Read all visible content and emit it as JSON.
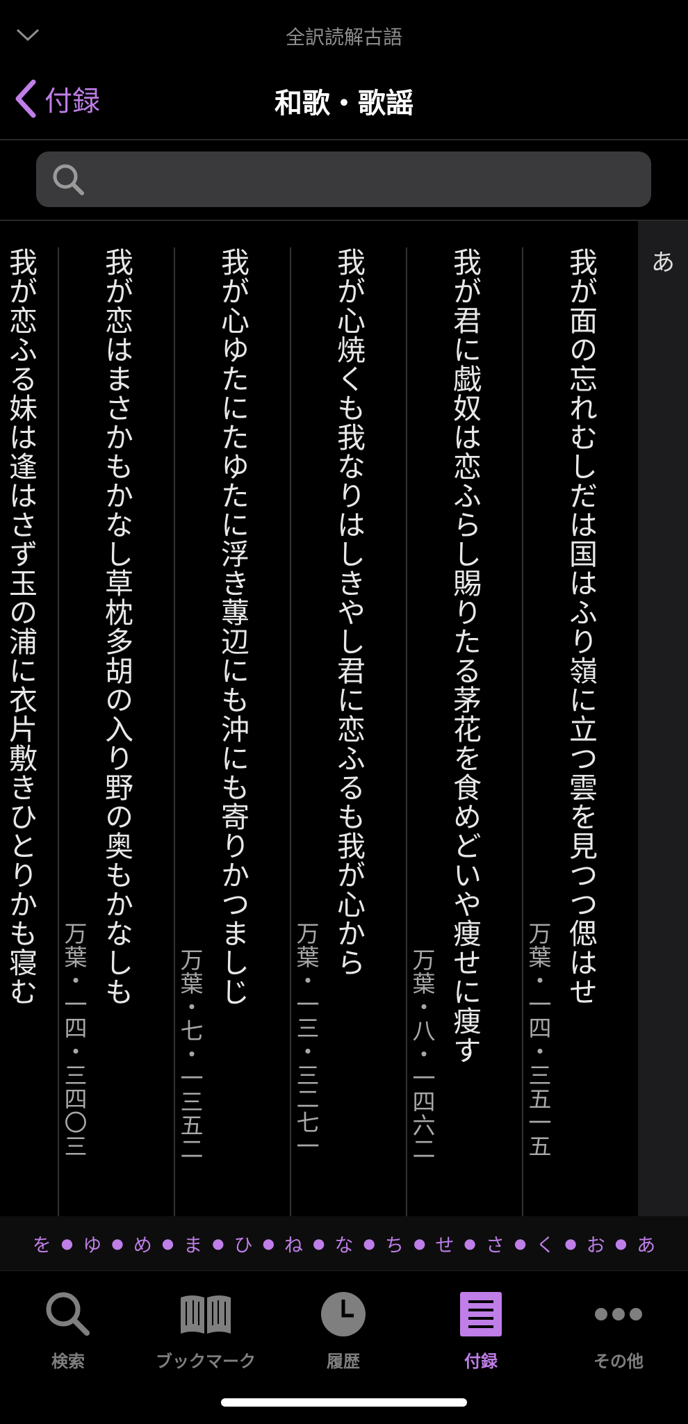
{
  "app": {
    "name": "全訳読解古語"
  },
  "nav": {
    "back_label": "付録",
    "title": "和歌・歌謡"
  },
  "search": {
    "placeholder": "",
    "value": ""
  },
  "poems": [
    {
      "text": "我が面の忘れむしだは国はふり嶺に立つ雲を見つつ偲はせ",
      "source": "万葉・一四・三五一五"
    },
    {
      "text": "我が君に戯奴は恋ふらし賜りたる茅花を食めどいや痩せに痩す",
      "source": "万葉・八・一四六二"
    },
    {
      "text": "我が心焼くも我なりはしきやし君に恋ふるも我が心から",
      "source": "万葉・一三・三二七一"
    },
    {
      "text": "我が心ゆたにたゆたに浮き蓴辺にも沖にも寄りかつましじ",
      "source": "万葉・七・一三五二"
    },
    {
      "text": "我が恋はまさかもかなし草枕多胡の入り野の奥もかなしも",
      "source": "万葉・一四・三四〇三"
    },
    {
      "text": "我が恋ふる妹は逢はさず玉の浦に衣片敷きひとりかも寝む",
      "source": ""
    }
  ],
  "index": {
    "current": "あ"
  },
  "kana_index": [
    "を",
    "ゆ",
    "め",
    "ま",
    "ひ",
    "ね",
    "な",
    "ち",
    "せ",
    "さ",
    "く",
    "お",
    "あ"
  ],
  "kana_separator": "●",
  "tabs": [
    {
      "label": "検索",
      "icon": "search-icon"
    },
    {
      "label": "ブックマーク",
      "icon": "book-icon"
    },
    {
      "label": "履歴",
      "icon": "clock-icon"
    },
    {
      "label": "付録",
      "icon": "list-icon",
      "active": true
    },
    {
      "label": "その他",
      "icon": "more-icon"
    }
  ],
  "colors": {
    "accent": "#bf7ee8",
    "background": "#000000",
    "inactive": "#7f7f7f"
  }
}
